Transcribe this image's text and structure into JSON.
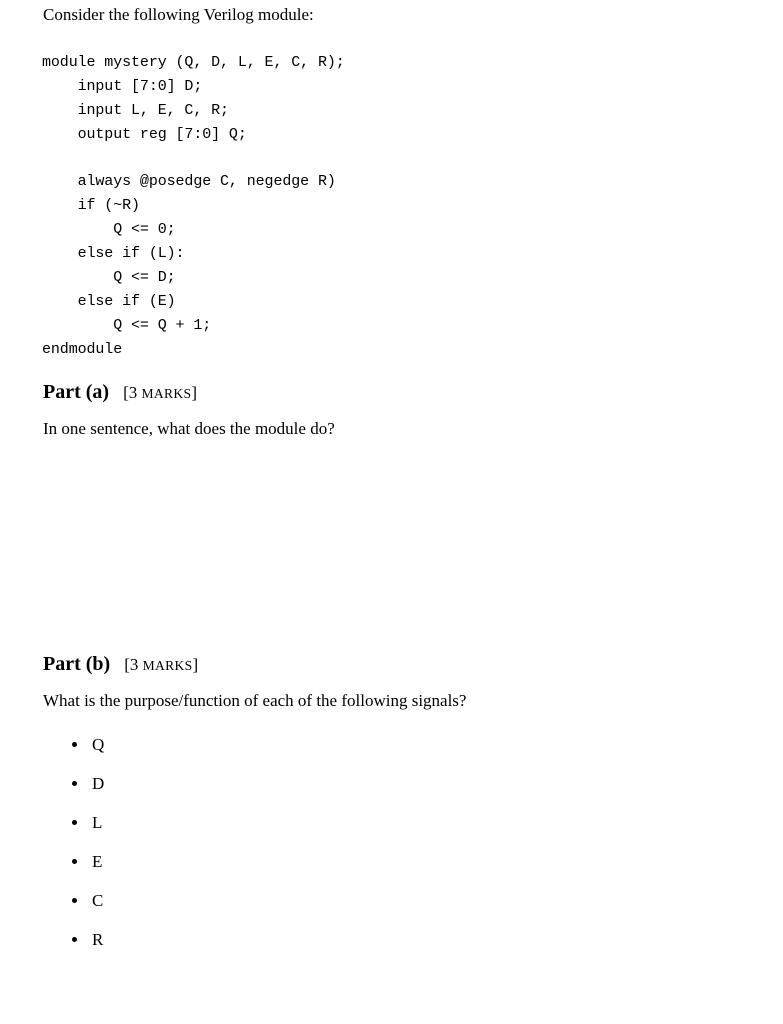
{
  "document": {
    "intro": "Consider the following Verilog module:",
    "code": {
      "language": "verilog",
      "lines": [
        "module mystery (Q, D, L, E, C, R);",
        "    input [7:0] D;",
        "    input L, E, C, R;",
        "    output reg [7:0] Q;",
        "",
        "    always @posedge C, negedge R)",
        "    if (~R)",
        "        Q <= 0;",
        "    else if (L):",
        "        Q <= D;",
        "    else if (E)",
        "        Q <= Q + 1;",
        "endmodule"
      ]
    },
    "parts": [
      {
        "title": "Part (a)",
        "marks_open": "[",
        "marks_value": "3",
        "marks_word": "marks",
        "marks_close": "]",
        "question": "In one sentence, what does the module do?"
      },
      {
        "title": "Part (b)",
        "marks_open": "[",
        "marks_value": "3",
        "marks_word": "marks",
        "marks_close": "]",
        "question": "What is the purpose/function of each of the following signals?"
      }
    ],
    "signals": [
      {
        "label": "Q"
      },
      {
        "label": "D"
      },
      {
        "label": "L"
      },
      {
        "label": "E"
      },
      {
        "label": "C"
      },
      {
        "label": "R"
      }
    ]
  },
  "colors": {
    "page_background": "#ffffff",
    "text": "#000000"
  }
}
